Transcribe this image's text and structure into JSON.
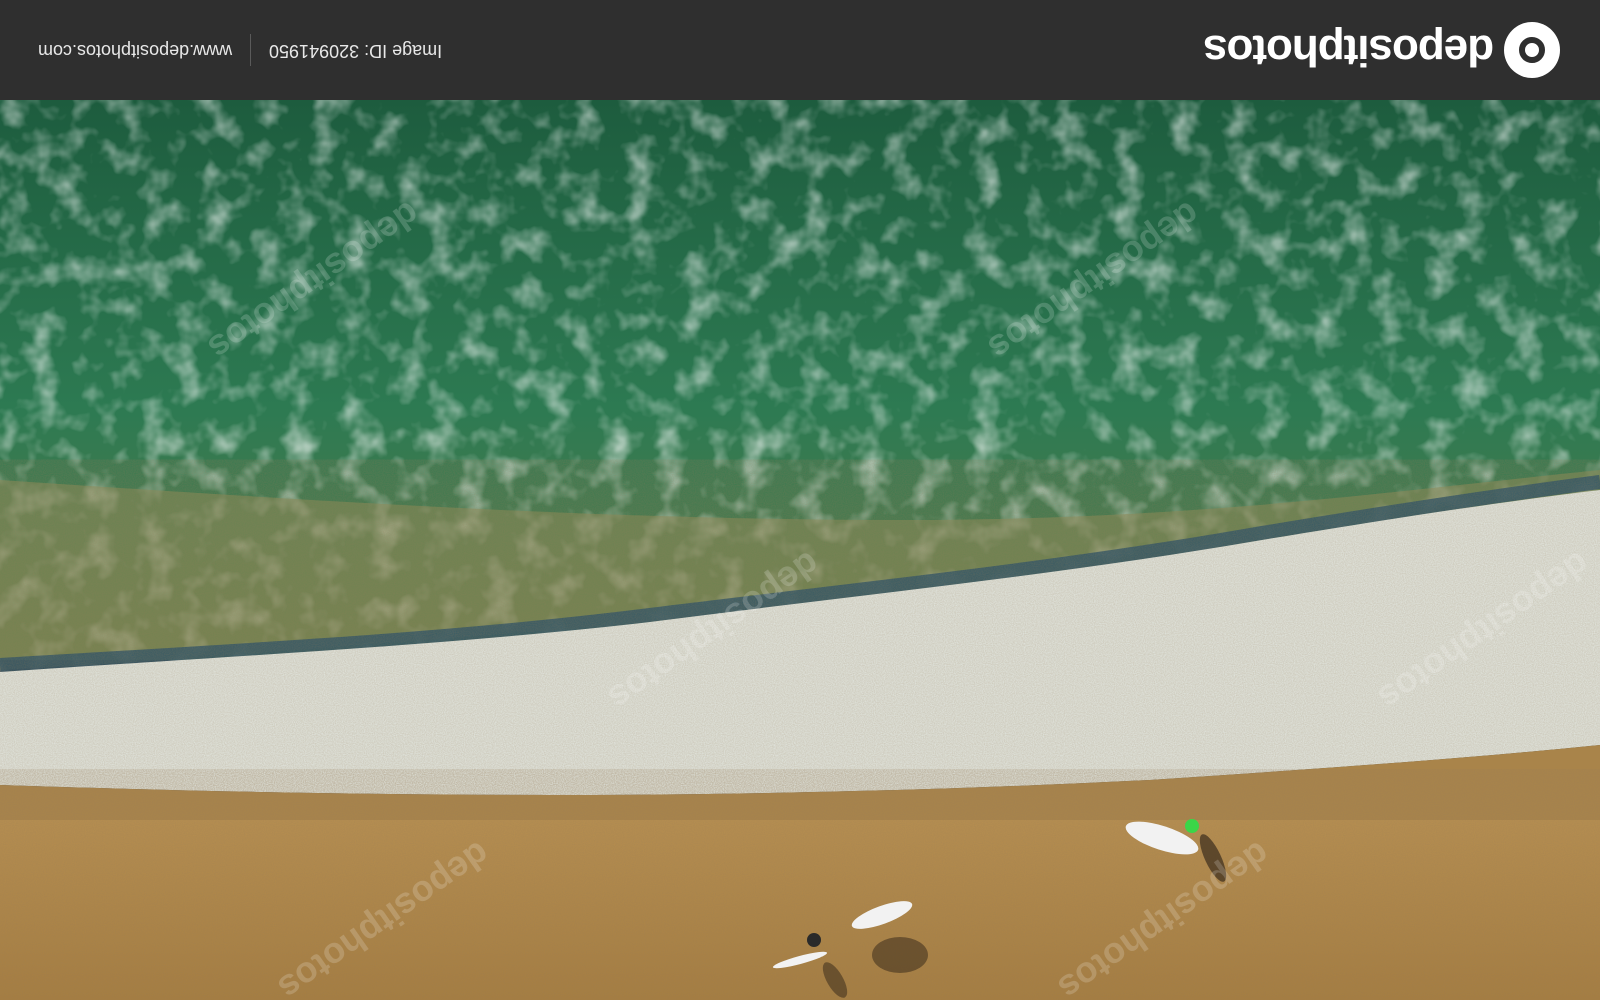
{
  "header": {
    "brand": "depositphotos",
    "image_id": "Image ID: 320941950",
    "site_url": "www.depositphotos.com"
  },
  "colors": {
    "bar": "#2f2f2f",
    "ocean_deep": "#1e5a3c",
    "ocean_mid": "#2f7a55",
    "foam": "#e9eee8",
    "sand": "#b78c4a",
    "sand_dark": "#9b7436"
  },
  "watermark": "depositphotos"
}
